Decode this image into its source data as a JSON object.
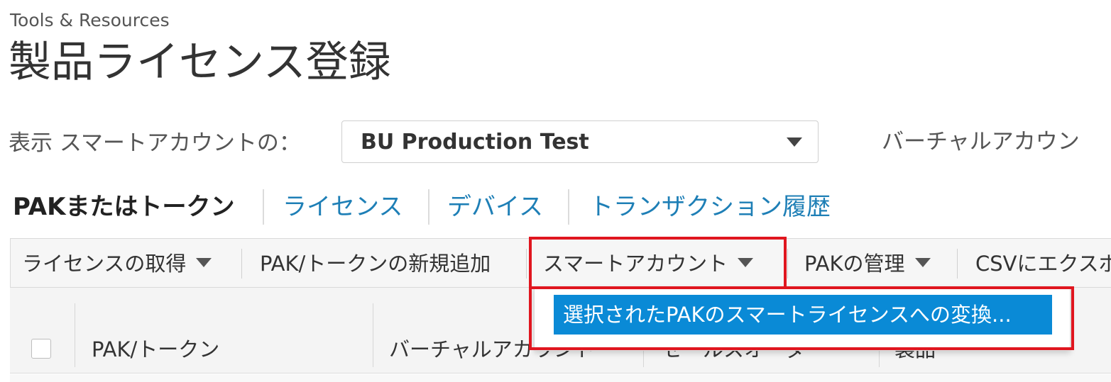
{
  "header": {
    "breadcrumb": "Tools & Resources",
    "title": "製品ライセンス登録"
  },
  "smart_account": {
    "label": "表示 スマートアカウントの：",
    "selected": "BU Production Test",
    "virtual_account_label": "バーチャルアカウン"
  },
  "tabs": [
    {
      "label": "PAKまたはトークン",
      "active": true
    },
    {
      "label": "ライセンス",
      "active": false
    },
    {
      "label": "デバイス",
      "active": false
    },
    {
      "label": "トランザクション履歴",
      "active": false
    }
  ],
  "toolbar": {
    "get_license": "ライセンスの取得",
    "add_pak": "PAK/トークンの新規追加",
    "smart_account": "スマートアカウント",
    "manage_pak": "PAKの管理",
    "export_csv": "CSVにエクスポ"
  },
  "dropdown": {
    "items": [
      "選択されたPAKのスマートライセンスへの変換..."
    ]
  },
  "table": {
    "columns": [
      "PAK/トークン",
      "バーチャルアカウント",
      "セールスオーダー",
      "製品"
    ]
  },
  "colors": {
    "link": "#1e7fb6",
    "highlight": "#e0161f",
    "menu_active": "#0a8ad6"
  }
}
